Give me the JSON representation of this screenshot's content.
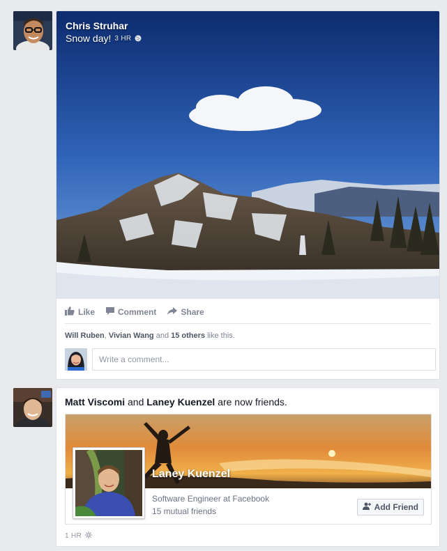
{
  "post1": {
    "author": "Chris Struhar",
    "caption": "Snow day!",
    "time": "3 HR",
    "actions": {
      "like": "Like",
      "comment": "Comment",
      "share": "Share"
    },
    "likes": {
      "name1": "Will Ruben",
      "sep1": ", ",
      "name2": "Vivian Wang",
      "sep2": " and ",
      "others": "15 others",
      "suffix": " like this."
    },
    "comment_placeholder": "Write a comment..."
  },
  "post2": {
    "story": {
      "name1": "Matt Viscomi",
      "joiner": " and ",
      "name2": "Laney Kuenzel",
      "suffix": " are now friends."
    },
    "friend": {
      "name": "Laney Kuenzel",
      "job": "Software Engineer at Facebook",
      "mutual": "15 mutual friends",
      "add_label": "Add Friend"
    },
    "time": "1 HR"
  },
  "colors": {
    "background": "#e9eaed",
    "card_border": "#dddfe2",
    "muted_text": "#7f8594"
  },
  "icons": [
    "globe-icon",
    "thumbs-up-icon",
    "comment-icon",
    "share-arrow-icon",
    "add-friend-icon",
    "privacy-icon"
  ]
}
